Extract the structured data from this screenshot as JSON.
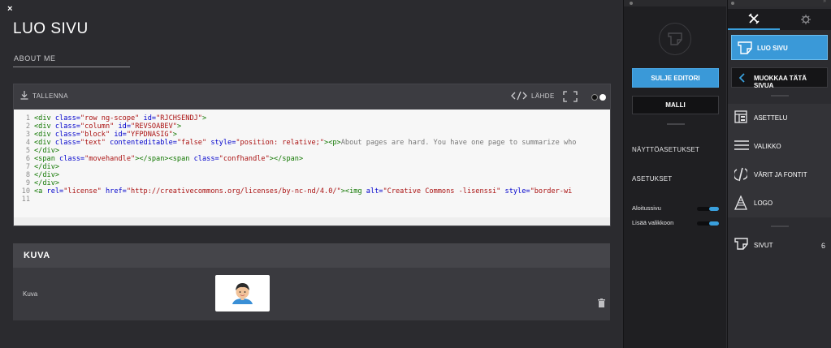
{
  "editor": {
    "close_icon": "×",
    "title": "LUO SIVU",
    "url_value": "ABOUT ME",
    "toolbar": {
      "save_label": "TALLENNA",
      "source_label": "LÄHDE"
    },
    "code": {
      "line_numbers": [
        "1",
        "2",
        "3",
        "4",
        "5",
        "6",
        "7",
        "8",
        "9",
        "10",
        "11"
      ]
    }
  },
  "image_section": {
    "heading": "KUVA",
    "label": "Kuva"
  },
  "middle_panel": {
    "close_editor_label": "SULJE EDITORI",
    "template_label": "MALLI",
    "display_settings_label": "NÄYTTÖASETUKSET",
    "settings_label": "ASETUKSET",
    "homepage_label": "Aloitussivu",
    "add_to_menu_label": "Lisää valikkoon"
  },
  "right_panel": {
    "create_page_label": "LUO SIVU",
    "edit_page_label": "MUOKKAA TÄTÄ SIVUA",
    "items": [
      {
        "label": "ASETTELU",
        "icon": "layout-icon"
      },
      {
        "label": "VALIKKO",
        "icon": "menu-icon"
      },
      {
        "label": "VÄRIT JA FONTIT",
        "icon": "design-icon"
      },
      {
        "label": "LOGO",
        "icon": "logo-icon"
      }
    ],
    "pages_label": "SIVUT",
    "pages_count": "6"
  },
  "colors": {
    "accent": "#3a99d8",
    "dark": "#1f1f22",
    "panel": "#2c2c30"
  }
}
